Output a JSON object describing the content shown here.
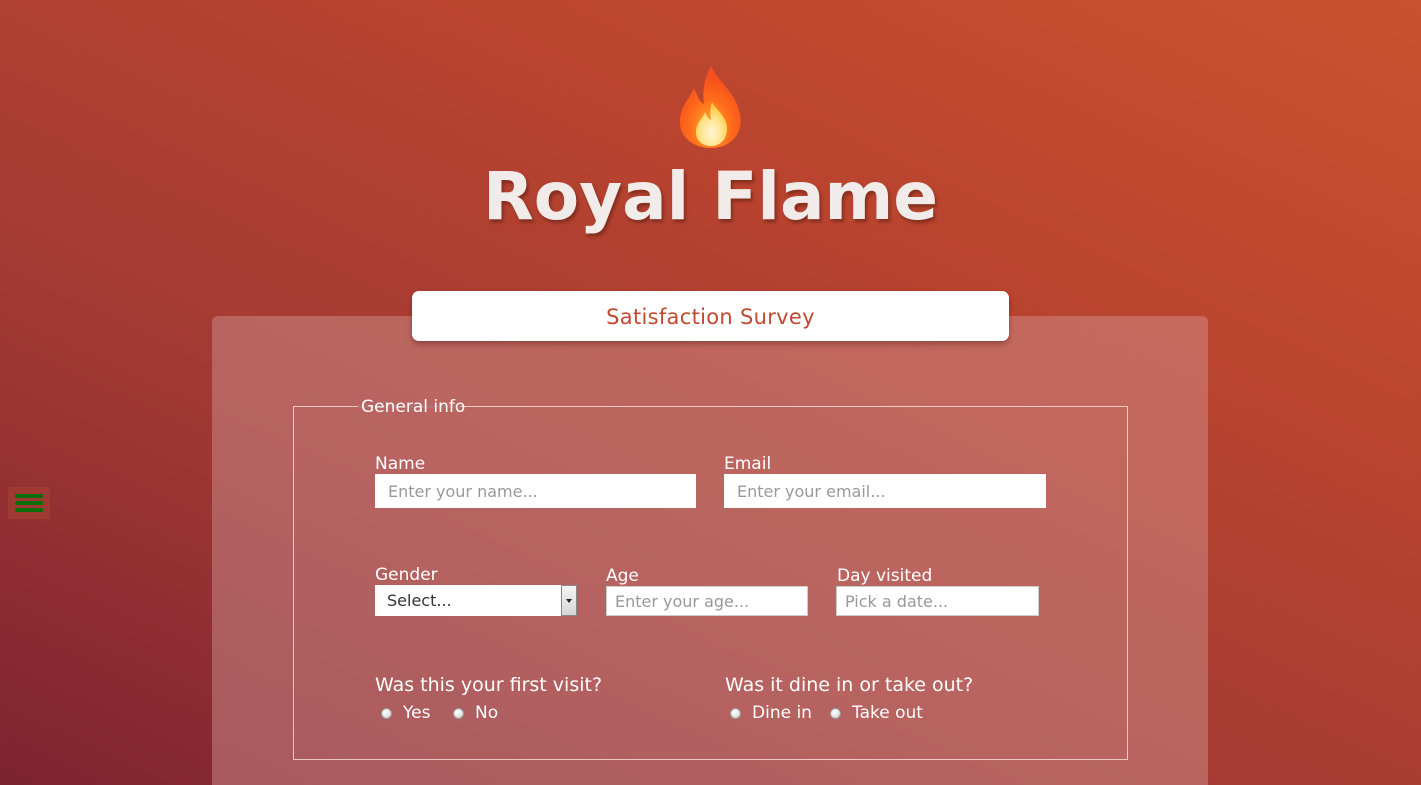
{
  "brand": {
    "logo_icon": "fire-icon",
    "title": "Royal Flame"
  },
  "menu": {
    "icon": "hamburger-menu-icon",
    "icon_color": "#0e6e0e"
  },
  "survey": {
    "tab_title": "Satisfaction Survey",
    "tab_title_color": "#c2482f",
    "section_legend": "General info",
    "name": {
      "label": "Name",
      "placeholder": "Enter your name...",
      "value": ""
    },
    "email": {
      "label": "Email",
      "placeholder": "Enter your email...",
      "value": ""
    },
    "gender": {
      "label": "Gender",
      "selected": "Select..."
    },
    "age": {
      "label": "Age",
      "placeholder": "Enter your age...",
      "value": ""
    },
    "day_visited": {
      "label": "Day visited",
      "placeholder": "Pick a date...",
      "value": ""
    },
    "first_visit": {
      "question": "Was this your first visit?",
      "options": [
        "Yes",
        "No"
      ]
    },
    "dine_type": {
      "question": "Was it dine in or take out?",
      "options": [
        "Dine in",
        "Take out"
      ]
    }
  },
  "colors": {
    "background_start": "#7d2330",
    "background_end": "#c9532f",
    "panel": "#c2827c"
  }
}
